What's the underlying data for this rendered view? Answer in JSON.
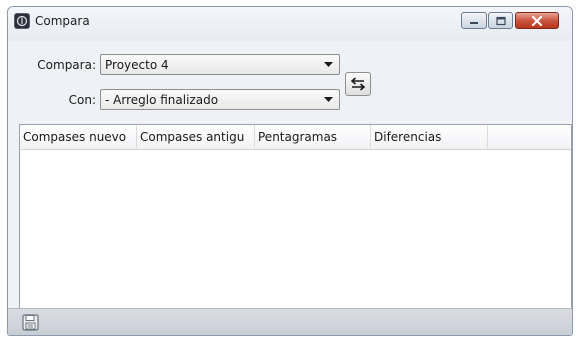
{
  "window": {
    "title": "Compara"
  },
  "form": {
    "compare_label": "Compara:",
    "compare_value": "Proyecto 4",
    "with_label": "Con:",
    "with_value": "- Arreglo finalizado"
  },
  "table": {
    "columns": [
      "Compases nuevo",
      "Compases antigu",
      "Pentagramas",
      "Diferencias",
      ""
    ],
    "rows": []
  },
  "icons": {
    "app": "app-icon",
    "minimize": "minimize-icon",
    "maximize": "maximize-icon",
    "close": "close-icon",
    "swap": "swap-arrows-icon",
    "save": "save-icon"
  },
  "colors": {
    "close_button": "#c84f38",
    "window_bg": "#eef1f5"
  }
}
